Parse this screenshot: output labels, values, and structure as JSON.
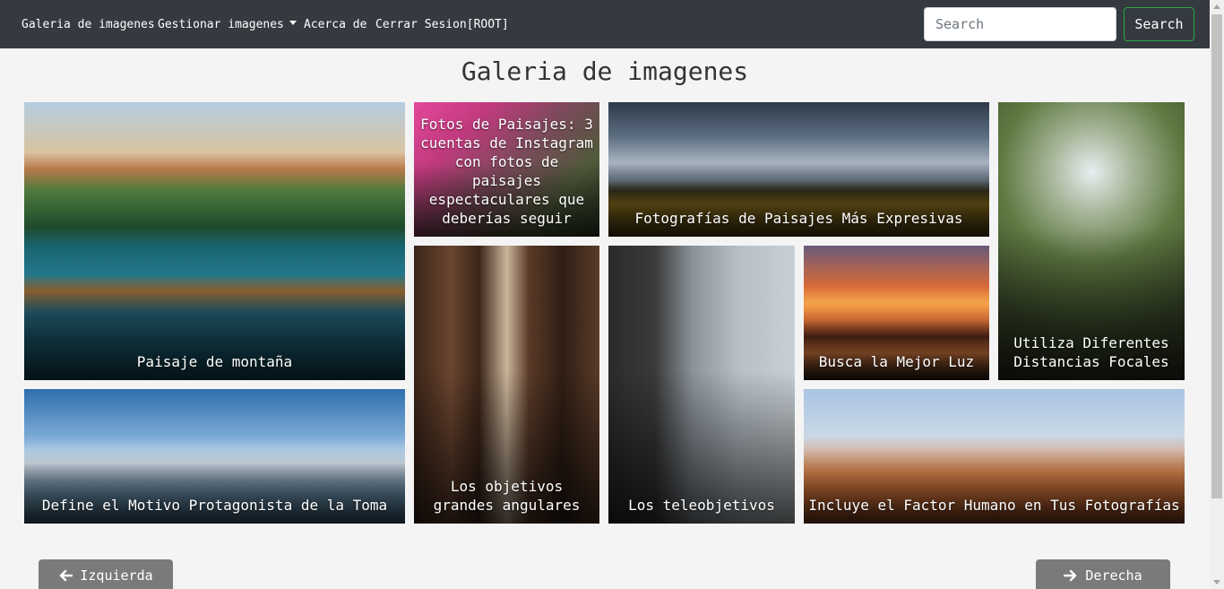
{
  "navbar": {
    "links": [
      {
        "label": "Galeria de imagenes"
      },
      {
        "label": "Gestionar imagenes"
      },
      {
        "label": "Acerca de"
      },
      {
        "label": "Cerrar Sesion[ROOT]"
      }
    ],
    "search": {
      "placeholder": "Search",
      "button_label": "Search"
    }
  },
  "page": {
    "title": "Galeria de imagenes"
  },
  "gallery": {
    "tiles": [
      {
        "caption": "Paisaje de montaña"
      },
      {
        "caption": "Fotos de Paisajes: 3 cuentas de Instagram con fotos de paisajes espectaculares que deberías seguir"
      },
      {
        "caption": "Fotografías de Paisajes Más Expresivas"
      },
      {
        "caption": "Utiliza Diferentes Distancias Focales"
      },
      {
        "caption": "Los objetivos grandes angulares"
      },
      {
        "caption": "Los teleobjetivos"
      },
      {
        "caption": "Busca la Mejor Luz"
      },
      {
        "caption": "Define el Motivo Protagonista de la Toma"
      },
      {
        "caption": "Incluye el Factor Humano en Tus Fotografías"
      }
    ]
  },
  "pagination": {
    "prev_label": "Izquierda",
    "next_label": "Derecha"
  }
}
